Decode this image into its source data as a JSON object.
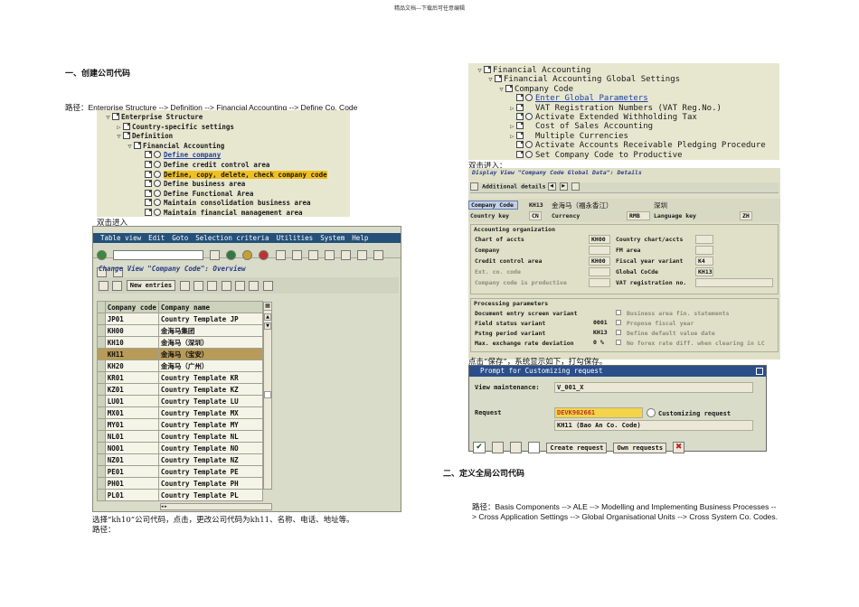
{
  "page_header": "精品文档---下载后可任意编辑",
  "section1": {
    "heading": "一、创建公司代码",
    "path": "路径：Enterprise Structure --> Definition --> Financial Accounting --> Define Co. Code",
    "tree": [
      {
        "toggle": "▽",
        "label": "Enterprise Structure",
        "indent": 0
      },
      {
        "toggle": "▷",
        "label": "Country-specific settings",
        "indent": 1
      },
      {
        "toggle": "▽",
        "label": "Definition",
        "indent": 1
      },
      {
        "toggle": "▽",
        "label": "Financial Accounting",
        "indent": 2
      },
      {
        "toggle": "",
        "label": "Define company",
        "indent": 3,
        "link": true
      },
      {
        "toggle": "",
        "label": "Define credit control area",
        "indent": 3
      },
      {
        "toggle": "",
        "label": "Define, copy, delete, check company code",
        "indent": 3,
        "highlight": true
      },
      {
        "toggle": "",
        "label": "Define business area",
        "indent": 3
      },
      {
        "toggle": "",
        "label": "Define Functional Area",
        "indent": 3
      },
      {
        "toggle": "",
        "label": "Maintain consolidation business area",
        "indent": 3
      },
      {
        "toggle": "",
        "label": "Maintain financial management area",
        "indent": 3
      }
    ],
    "dblclick_note": "双击进入",
    "sap_window": {
      "menu": [
        "Table view",
        "Edit",
        "Goto",
        "Selection criteria",
        "Utilities",
        "System",
        "Help"
      ],
      "title": "Change View \"Company Code\": Overview",
      "new_entries": "New entries",
      "col_code": "Company code",
      "col_name": "Company name",
      "rows": [
        {
          "code": "JP01",
          "name": "Country Template JP"
        },
        {
          "code": "KH00",
          "name": "金海马集团"
        },
        {
          "code": "KH10",
          "name": "金海马（深圳）"
        },
        {
          "code": "KH11",
          "name": "金海马（宝安）",
          "highlight": true
        },
        {
          "code": "KH20",
          "name": "金海马（广州）"
        },
        {
          "code": "KR01",
          "name": "Country Template KR"
        },
        {
          "code": "KZ01",
          "name": "Country Template KZ"
        },
        {
          "code": "LU01",
          "name": "Country Template LU"
        },
        {
          "code": "MX01",
          "name": "Country Template MX"
        },
        {
          "code": "MY01",
          "name": "Country Template MY"
        },
        {
          "code": "NL01",
          "name": "Country Template NL"
        },
        {
          "code": "NO01",
          "name": "Country Template NO"
        },
        {
          "code": "NZ01",
          "name": "Country Template NZ"
        },
        {
          "code": "PE01",
          "name": "Country Template PE"
        },
        {
          "code": "PH01",
          "name": "Country Template PH"
        },
        {
          "code": "PL01",
          "name": "Country Template PL"
        }
      ]
    },
    "select_note": "选择“kh10”公司代码，点击，更改公司代码为kh11、名称、电话、地址等。",
    "select_note2": "路径："
  },
  "right_tree": [
    {
      "toggle": "▽",
      "label": "Financial Accounting",
      "indent": 0
    },
    {
      "toggle": "▽",
      "label": "Financial Accounting Global Settings",
      "indent": 1
    },
    {
      "toggle": "▽",
      "label": "Company Code",
      "indent": 2
    },
    {
      "toggle": "",
      "label": "Enter Global Parameters",
      "indent": 3,
      "link": true
    },
    {
      "toggle": "▷",
      "label": "VAT Registration Numbers (VAT Reg.No.)",
      "indent": 3
    },
    {
      "toggle": "",
      "label": "Activate Extended Withholding Tax",
      "indent": 3
    },
    {
      "toggle": "▷",
      "label": "Cost of Sales Accounting",
      "indent": 3
    },
    {
      "toggle": "▷",
      "label": "Multiple Currencies",
      "indent": 3
    },
    {
      "toggle": "",
      "label": "Activate Accounts Receivable Pledging Procedure",
      "indent": 3
    },
    {
      "toggle": "",
      "label": "Set Company Code to Productive",
      "indent": 3
    }
  ],
  "right_note1": "双击进入：",
  "detail": {
    "title": "Display View \"Company Code Global Data\": Details",
    "additional_details": "Additional details",
    "company_code_label": "Company Code",
    "company_code": "KH13",
    "company_name": "金海马（福永香江）",
    "city": "深圳",
    "country_key_label": "Country key",
    "country_key": "CN",
    "currency_label": "Currency",
    "currency": "RMB",
    "language_key_label": "Language key",
    "language_key": "ZH",
    "acct_org_tab": "Accounting organization",
    "acct_rows": [
      {
        "l1": "Chart of accts",
        "v1": "KH00",
        "l2": "Country chart/accts",
        "v2": "",
        "grey": false
      },
      {
        "l1": "Company",
        "v1": "",
        "l2": "FM area",
        "v2": "",
        "grey": false
      },
      {
        "l1": "Credit control area",
        "v1": "KH00",
        "l2": "Fiscal year variant",
        "v2": "K4",
        "grey": false
      },
      {
        "l1": "Ext. co. code",
        "v1": "",
        "l2": "Global CoCde",
        "v2": "KH13",
        "grey": true
      },
      {
        "l1": "Company code is productive",
        "v1": "",
        "l2": "VAT registration no.",
        "v2": "",
        "grey": true
      }
    ],
    "proc_tab": "Processing parameters",
    "proc_rows": [
      {
        "l1": "Document entry screen variant",
        "v1": "",
        "l2": "Business area fin. statements"
      },
      {
        "l1": "Field status variant",
        "v1": "0001",
        "l2": "Propose fiscal year"
      },
      {
        "l1": "Pstng period variant",
        "v1": "KH13",
        "l2": "Define default value date"
      },
      {
        "l1": "Max. exchange rate deviation",
        "v1": "0 %",
        "l2": "No forex rate diff. when clearing in LC"
      }
    ]
  },
  "right_note2": "点击“保存”，系统显示如下，打勾保存。",
  "dialog": {
    "title": "Prompt for Customizing request",
    "view_label": "View maintenance:",
    "view_value": "V_001_X",
    "request_label": "Request",
    "request_value": "DEVK902661",
    "customizing_request": "Customizing request",
    "request_desc": "KH11 (Bao An Co. Code)",
    "create_request": "Create request",
    "own_requests": "Own requests"
  },
  "section2": {
    "heading": "二、定义全局公司代码",
    "path": "路径：Basis Components --> ALE --> Modelling and Implementing Business Processes --> Cross Application Settings --> Global Organisational Units --> Cross System Co. Codes."
  }
}
